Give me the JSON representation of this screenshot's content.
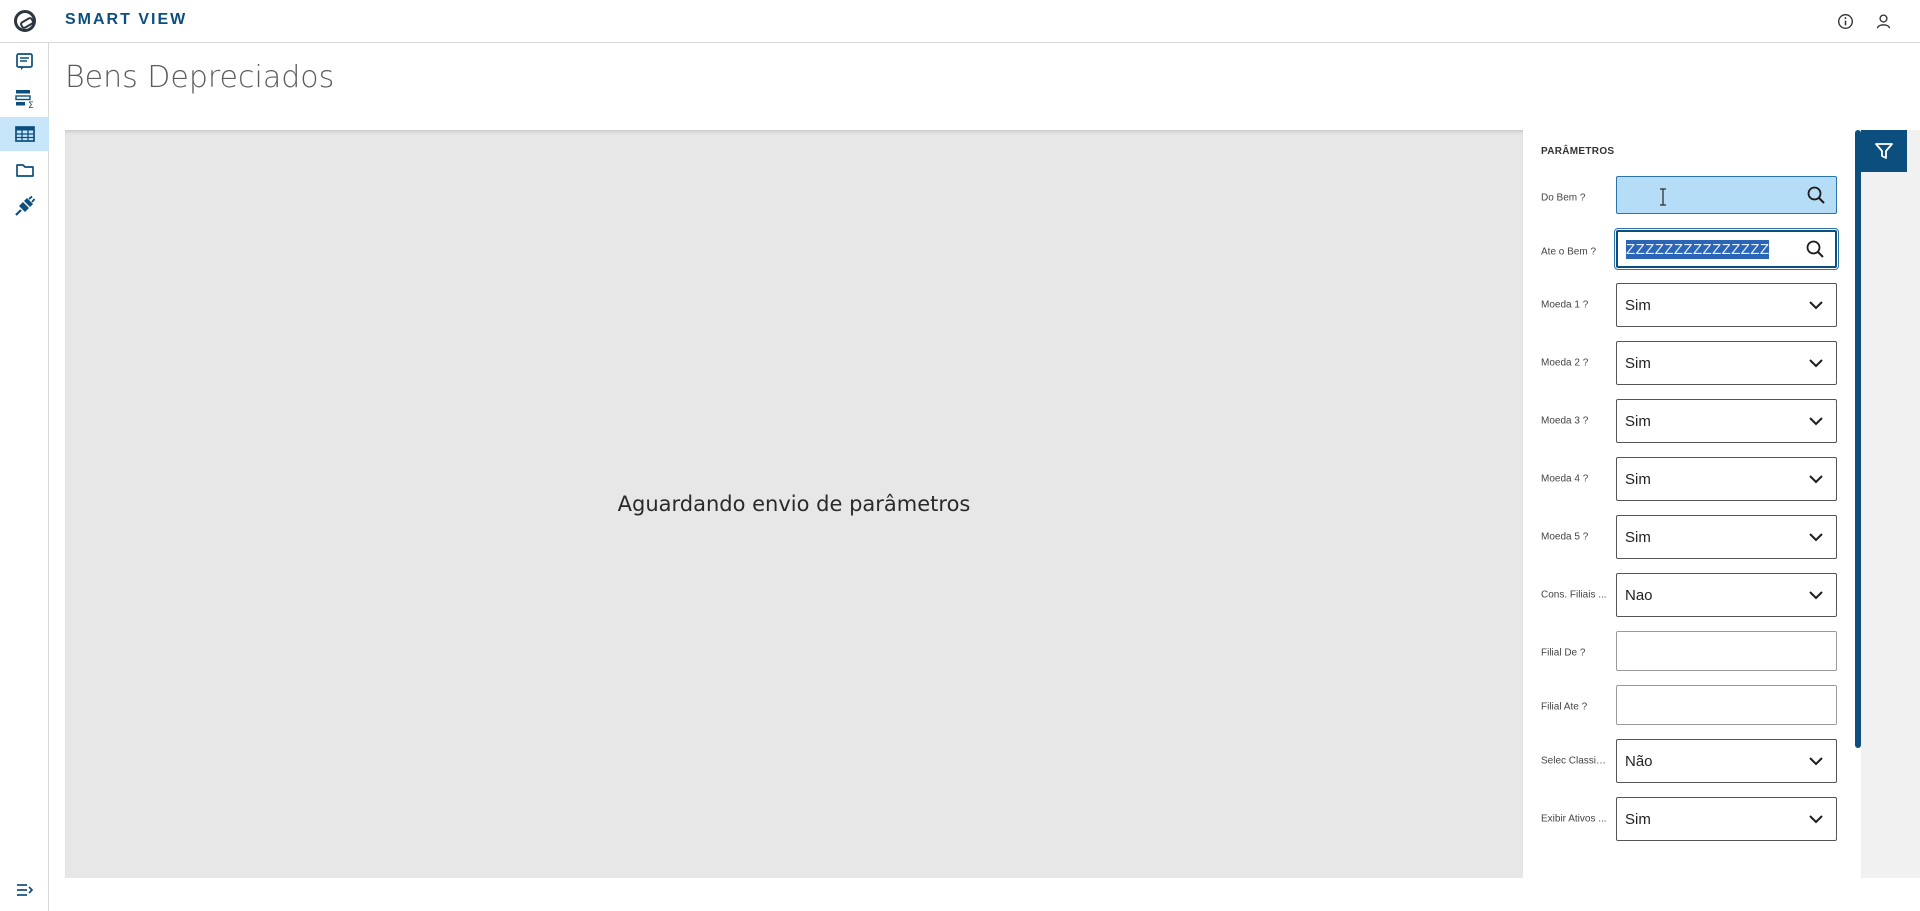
{
  "app": {
    "title": "SMART VIEW"
  },
  "page": {
    "title": "Bens Depreciados"
  },
  "result": {
    "message": "Aguardando envio de parâmetros"
  },
  "params": {
    "header": "PARÂMETROS",
    "items": [
      {
        "label": "Do Bem ?",
        "value": "",
        "type": "lookup"
      },
      {
        "label": "Ate o Bem ?",
        "value": "ZZZZZZZZZZZZZZZ",
        "type": "lookup"
      },
      {
        "label": "Moeda 1 ?",
        "value": "Sim",
        "type": "select"
      },
      {
        "label": "Moeda 2 ?",
        "value": "Sim",
        "type": "select"
      },
      {
        "label": "Moeda 3 ?",
        "value": "Sim",
        "type": "select"
      },
      {
        "label": "Moeda 4 ?",
        "value": "Sim",
        "type": "select"
      },
      {
        "label": "Moeda 5 ?",
        "value": "Sim",
        "type": "select"
      },
      {
        "label": "Cons. Filiais ...",
        "value": "Nao",
        "type": "select"
      },
      {
        "label": "Filial De ?",
        "value": "",
        "type": "text"
      },
      {
        "label": "Filial Ate ?",
        "value": "",
        "type": "text"
      },
      {
        "label": "Selec Classif ...",
        "value": "Não",
        "type": "select"
      },
      {
        "label": "Exibir Ativos ...",
        "value": "Sim",
        "type": "select"
      }
    ]
  },
  "icons": {
    "logo": "totvs-logo-icon",
    "info": "info-icon",
    "user": "user-icon",
    "sidebar": [
      "report-icon",
      "data-view-icon",
      "table-icon",
      "folder-icon",
      "plug-icon"
    ],
    "collapse": "expand-menu-icon",
    "search": "search-icon",
    "chevron": "chevron-down-icon",
    "filter": "filter-icon"
  },
  "colors": {
    "accent": "#0c4f7f",
    "active_bg": "#c8e6fa",
    "focus_bg": "#b5ddf8",
    "result_bg": "#e7e7e7",
    "selection": "#2b65b8"
  }
}
